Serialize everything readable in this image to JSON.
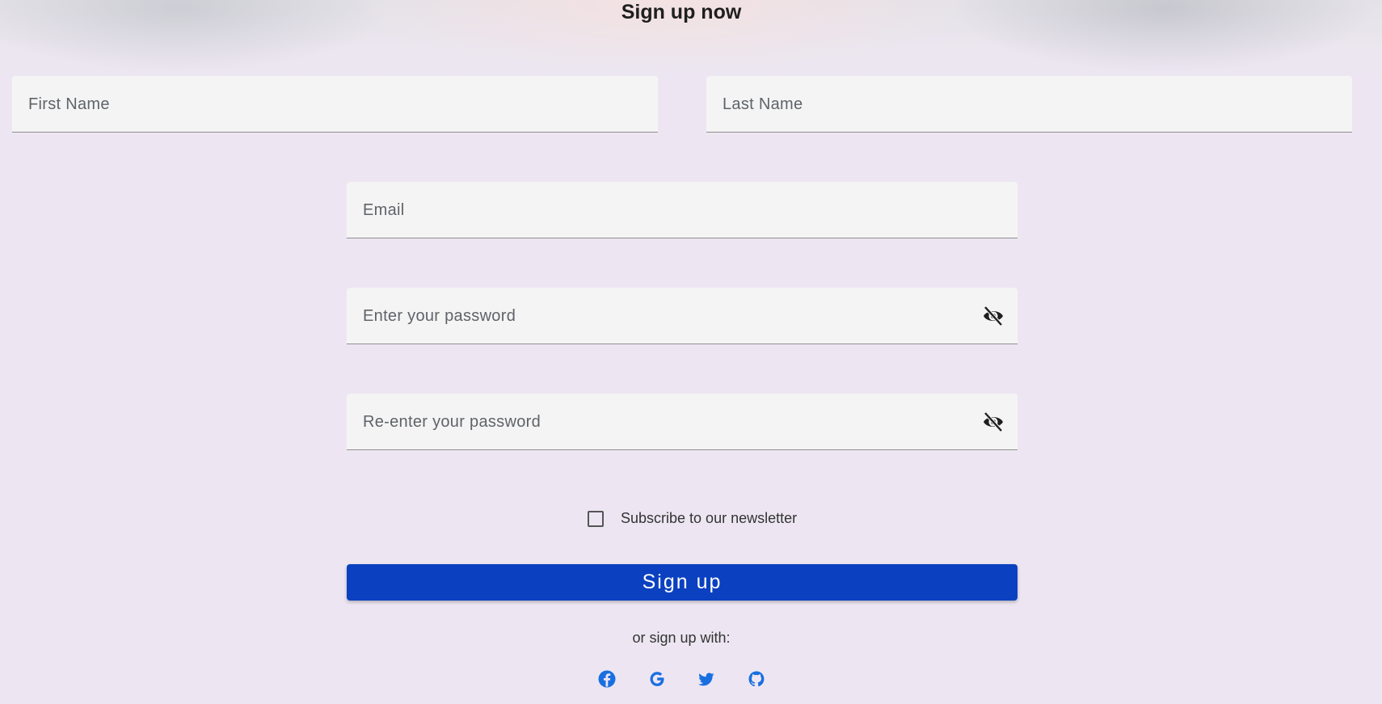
{
  "header": {
    "title": "Sign up now"
  },
  "form": {
    "first_name": {
      "placeholder": "First Name"
    },
    "last_name": {
      "placeholder": "Last Name"
    },
    "email": {
      "placeholder": "Email"
    },
    "password": {
      "placeholder": "Enter your password",
      "visibility_icon": "eye-off-icon"
    },
    "confirm_password": {
      "placeholder": "Re-enter your password",
      "visibility_icon": "eye-off-icon"
    },
    "newsletter": {
      "label": "Subscribe to our newsletter",
      "checked": false
    },
    "submit_label": "Sign up"
  },
  "social": {
    "prompt": "or sign up with:",
    "providers": [
      {
        "name": "facebook",
        "icon": "facebook-icon"
      },
      {
        "name": "google",
        "icon": "google-icon"
      },
      {
        "name": "twitter",
        "icon": "twitter-icon"
      },
      {
        "name": "github",
        "icon": "github-icon"
      }
    ]
  },
  "colors": {
    "background": "#ede6f2",
    "field": "#f4f4f4",
    "primary": "#0b41c0",
    "social_icon": "#1a6fe0"
  }
}
